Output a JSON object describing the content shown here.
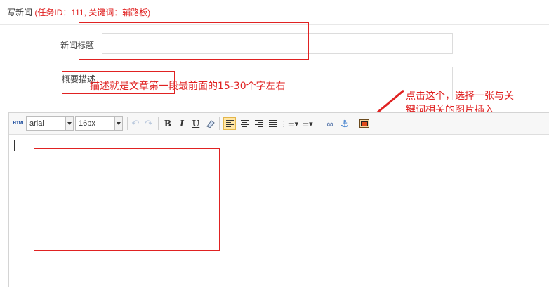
{
  "header": {
    "title": "写新闻",
    "subtitle": "(任务ID：111, 关键词：辅路板)"
  },
  "form": {
    "title_label": "新闻标题",
    "title_value": "",
    "summary_label": "概要描述",
    "summary_value": ""
  },
  "annotations": {
    "summary_hint": "描述就是文章第一段最前面的15-30个字左右",
    "image_hint_line1": "点击这个，选择一张与关",
    "image_hint_line2": "键词相关的图片插入"
  },
  "toolbar": {
    "html_label": "HTML",
    "font_family": "arial",
    "font_size": "16px",
    "bold": "B",
    "italic": "I",
    "underline": "U"
  },
  "colors": {
    "annotation_red": "#e02222"
  }
}
